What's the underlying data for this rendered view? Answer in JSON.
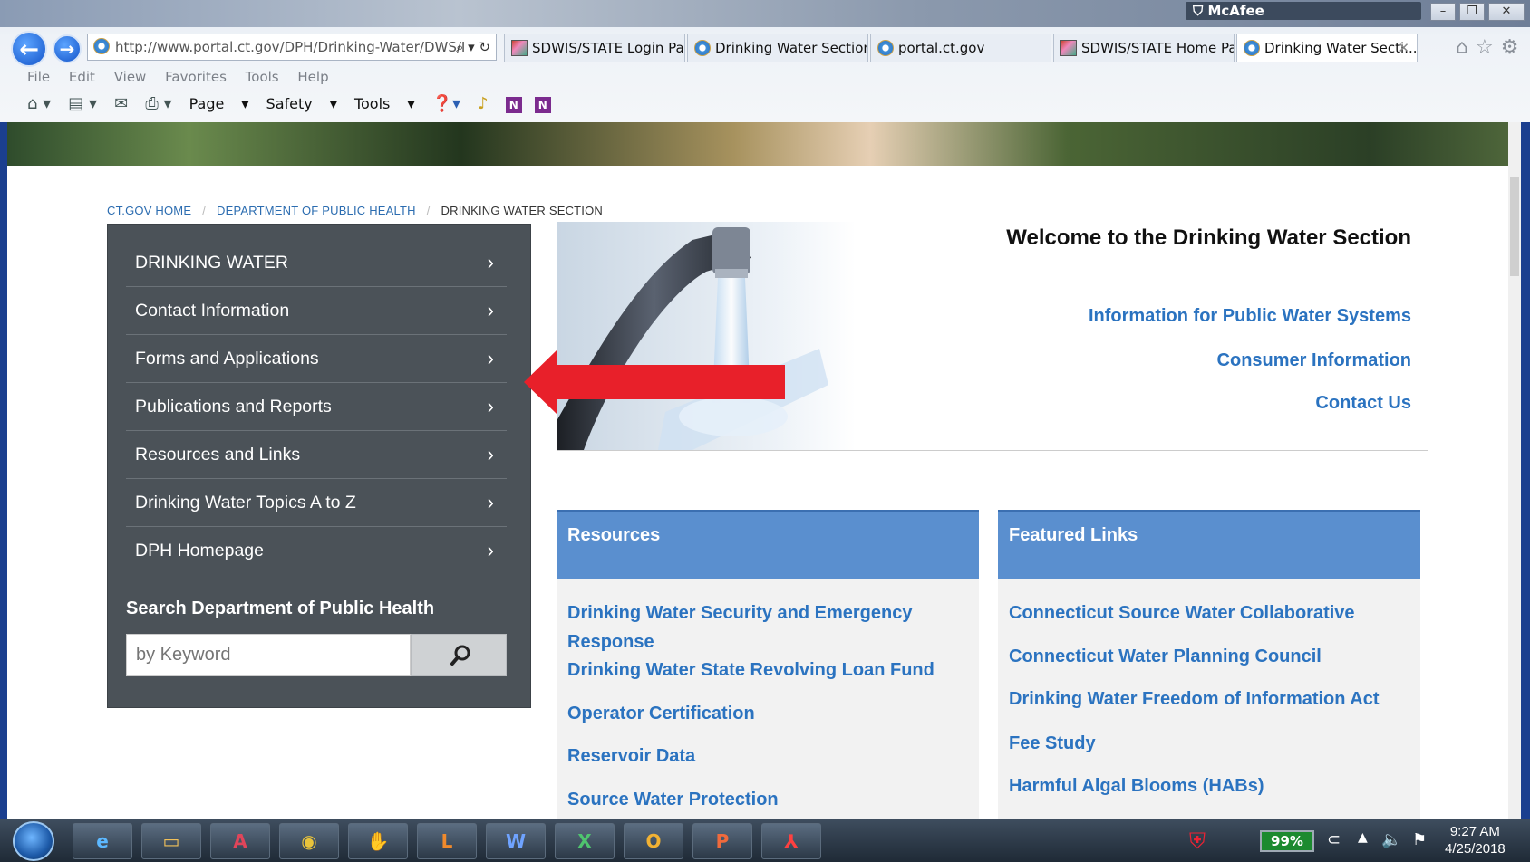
{
  "browser": {
    "title_badge": "McAfee",
    "address": "http://www.portal.ct.gov/DPH/Drinking-Water/DWS/I",
    "tabs": [
      {
        "label": "SDWIS/STATE Login Page",
        "icon": "image-icon"
      },
      {
        "label": "Drinking Water Section",
        "icon": "ie-icon"
      },
      {
        "label": "portal.ct.gov",
        "icon": "ie-icon"
      },
      {
        "label": "SDWIS/STATE Home Pa...",
        "icon": "image-icon"
      },
      {
        "label": "Drinking Water Secti...",
        "icon": "ie-icon",
        "active": true
      }
    ],
    "menu": [
      "File",
      "Edit",
      "View",
      "Favorites",
      "Tools",
      "Help"
    ],
    "commands": [
      "Page",
      "Safety",
      "Tools"
    ]
  },
  "breadcrumb": {
    "home": "CT.GOV HOME",
    "dept": "DEPARTMENT OF PUBLIC HEALTH",
    "current": "DRINKING WATER SECTION"
  },
  "sidebar": {
    "items": [
      {
        "label": "DRINKING WATER"
      },
      {
        "label": "Contact Information"
      },
      {
        "label": "Forms and Applications"
      },
      {
        "label": "Publications and Reports"
      },
      {
        "label": "Resources and Links"
      },
      {
        "label": "Drinking Water Topics A to Z"
      },
      {
        "label": "DPH Homepage"
      }
    ],
    "search_title": "Search Department of Public Health",
    "search_placeholder": "by Keyword"
  },
  "main": {
    "welcome": "Welcome to the Drinking Water Section",
    "quick_links": [
      "Information for Public Water Systems",
      "Consumer Information",
      "Contact Us"
    ]
  },
  "resources": {
    "title": "Resources",
    "links": [
      "Drinking Water Security and Emergency Response",
      "Drinking Water State Revolving Loan Fund",
      "Operator Certification",
      "Reservoir Data",
      "Source Water Protection"
    ]
  },
  "featured": {
    "title": "Featured Links",
    "links": [
      "Connecticut Source Water Collaborative",
      "Connecticut Water Planning Council",
      "Drinking Water Freedom of Information Act",
      "Fee Study",
      "Harmful Algal Blooms (HABs)"
    ]
  },
  "taskbar": {
    "apps": [
      "ie-icon",
      "folder-icon",
      "access-icon",
      "chrome-icon",
      "app-icon",
      "lync-icon",
      "word-icon",
      "excel-icon",
      "outlook-icon",
      "powerpoint-icon",
      "acrobat-icon"
    ],
    "battery": "99%",
    "time": "9:27 AM",
    "date": "4/25/2018"
  },
  "colors": {
    "sidebar_bg": "#4b5258",
    "link": "#2b73c0",
    "panel_head": "#5a8fcf",
    "arrow": "#e8202a"
  }
}
